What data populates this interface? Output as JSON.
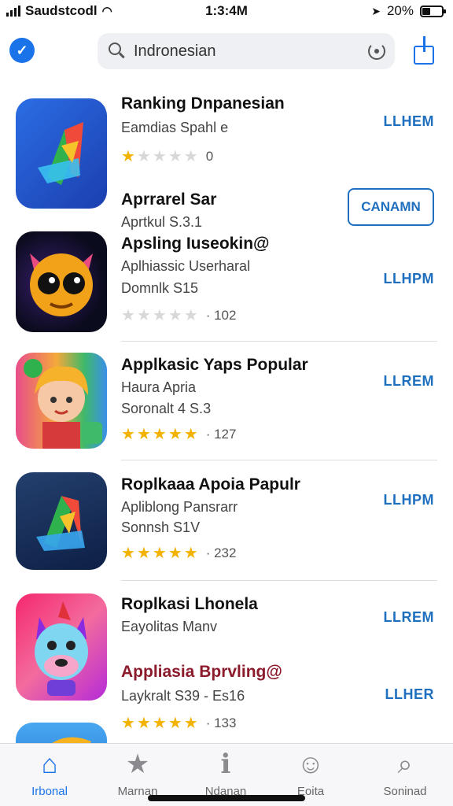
{
  "status": {
    "carrier": "Saudstcodl",
    "time": "1:3:4M",
    "battery": "20%"
  },
  "search": {
    "value": "Indronesian"
  },
  "apps": [
    {
      "title": "Ranking Dnpanesian",
      "subtitle": "Eamdias Spahl e",
      "stars": 1,
      "rating_count": "0",
      "action": "LLHEM"
    },
    {
      "title": "Aprrarel Sar",
      "subtitle": "Aprtkul S.3.1",
      "action": "CANAMN"
    },
    {
      "title": "Apsling Iuseokin@",
      "subtitle": "Aplhiassic Userharal",
      "subtitle2": "Domnlk S15",
      "stars": 0,
      "rating_count": "· 102",
      "action": "LLHPM"
    },
    {
      "title": "Applkasic Yaps Popular",
      "subtitle": "Haura Apria",
      "subtitle2": "Soronalt 4 S.3",
      "stars": 5,
      "rating_count": "· 127",
      "action": "LLREM"
    },
    {
      "title": "Roplkaaa Apoia Papulr",
      "subtitle": "Apliblong Pansrarr",
      "subtitle2": "Sonnsh S1V",
      "stars": 5,
      "rating_count": "· 232",
      "action": "LLHPM"
    },
    {
      "title": "Roplkasi Lhonela",
      "subtitle": "Eayolitas Manv",
      "action": "LLREM"
    },
    {
      "title": "Appliasia Bprvling@",
      "subtitle": "Laykralt S39 - Es16",
      "stars": 5,
      "rating_count": "· 133",
      "action": "LLHER",
      "title_color": "#8b1a2b"
    }
  ],
  "tabs": [
    {
      "label": "Irbonal",
      "icon": "home-icon",
      "active": true
    },
    {
      "label": "Marnan",
      "icon": "star-icon"
    },
    {
      "label": "Ndanan",
      "icon": "info-icon"
    },
    {
      "label": "Eoita",
      "icon": "chat-icon"
    },
    {
      "label": "Soninad",
      "icon": "search-icon"
    }
  ],
  "colors": {
    "accent": "#1a73e8",
    "link": "#1f6fbf",
    "star": "#f2b200"
  }
}
